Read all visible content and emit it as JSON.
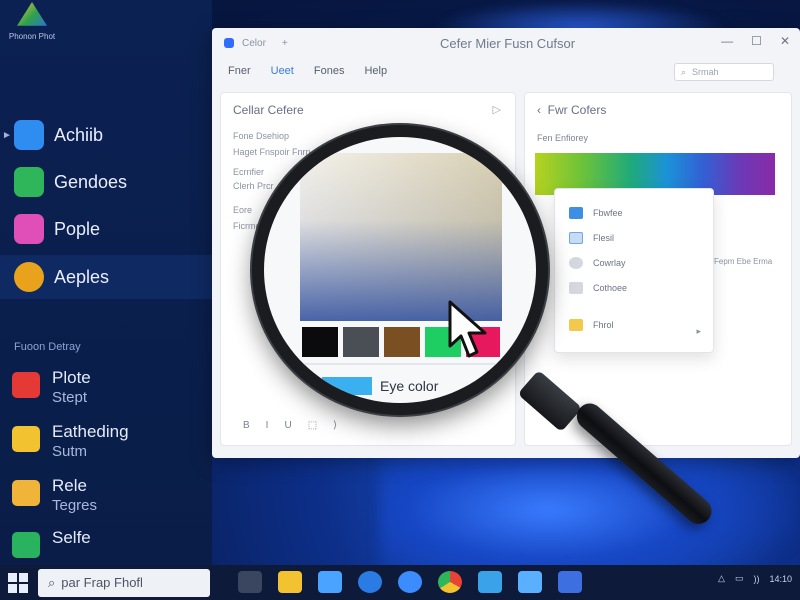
{
  "desktop": {
    "icon_label": "Phonon Phot"
  },
  "sidebar": {
    "apps": [
      {
        "label": "Achiib",
        "color": "#2f8cf0"
      },
      {
        "label": "Gendoes",
        "color": "#2fb65a"
      },
      {
        "label": "Pople",
        "color": "#e04fb8"
      },
      {
        "label": "Aeples",
        "color": "#e8a21c"
      }
    ],
    "section_label": "Fuoon Detray",
    "pinned": [
      {
        "label": "Plote",
        "sub": "Stept",
        "color": "#e53935"
      },
      {
        "label": "Eatheding",
        "sub": "Sutm",
        "color": "#f2c230"
      },
      {
        "label": "Rele",
        "sub": "Tegres",
        "color": "#f0b43a"
      },
      {
        "label": "Selfe",
        "sub": "",
        "color": "#29b35e"
      }
    ]
  },
  "window": {
    "tab_small_1": "Celor",
    "tab_small_2": "+",
    "title": "Cefer Mier Fusn Cufsor",
    "controls": [
      "—",
      "☐",
      "✕"
    ],
    "menu": [
      "Fner",
      "Ueet",
      "Fones",
      "Help"
    ],
    "search_placeholder": "Srmah",
    "left_pane": {
      "header": "Cellar Cefere",
      "lines": [
        "Fone Dsehiop",
        "Haget Fnspoir Fnrn",
        "Ecrnfier",
        "Clerh Prcr",
        "Eore",
        "Ficrmo"
      ],
      "toolbar": [
        "B",
        "I",
        "U",
        "⬚",
        "⟩"
      ]
    },
    "right_pane": {
      "header": "Fwr Cofers",
      "sub": "Fen Enfiorey",
      "note": "Fepm Ebe Erma"
    },
    "dropdown": [
      {
        "label": "Fbwfee",
        "color": "#3d8fe6"
      },
      {
        "label": "Flesil",
        "color": "#c7dbf5"
      },
      {
        "label": "Cowrlay",
        "color": "#d4d7dd"
      },
      {
        "label": "Cothoee",
        "color": "#d4d7dd"
      },
      {
        "label": "Fhrol",
        "color": "#f2c94c"
      }
    ]
  },
  "magnifier": {
    "swatches": [
      "#0b0b0d",
      "#4a4e55",
      "#7a4f22",
      "#1fce63",
      "#e8185e"
    ],
    "eye_color_swatch": "#3ab0f0",
    "eye_color_label": "Eye color"
  },
  "taskbar": {
    "search_text": "par Frap Fhofl",
    "apps": [
      "#dfe6f2",
      "#f2c230",
      "#4aa3ff",
      "#2a7be4",
      "#3b8cff",
      "#e94335",
      "#39a2e8",
      "#5ab0ff",
      "#3d6fe0"
    ],
    "tray": [
      "△",
      "▭",
      "))",
      "14:10"
    ]
  }
}
